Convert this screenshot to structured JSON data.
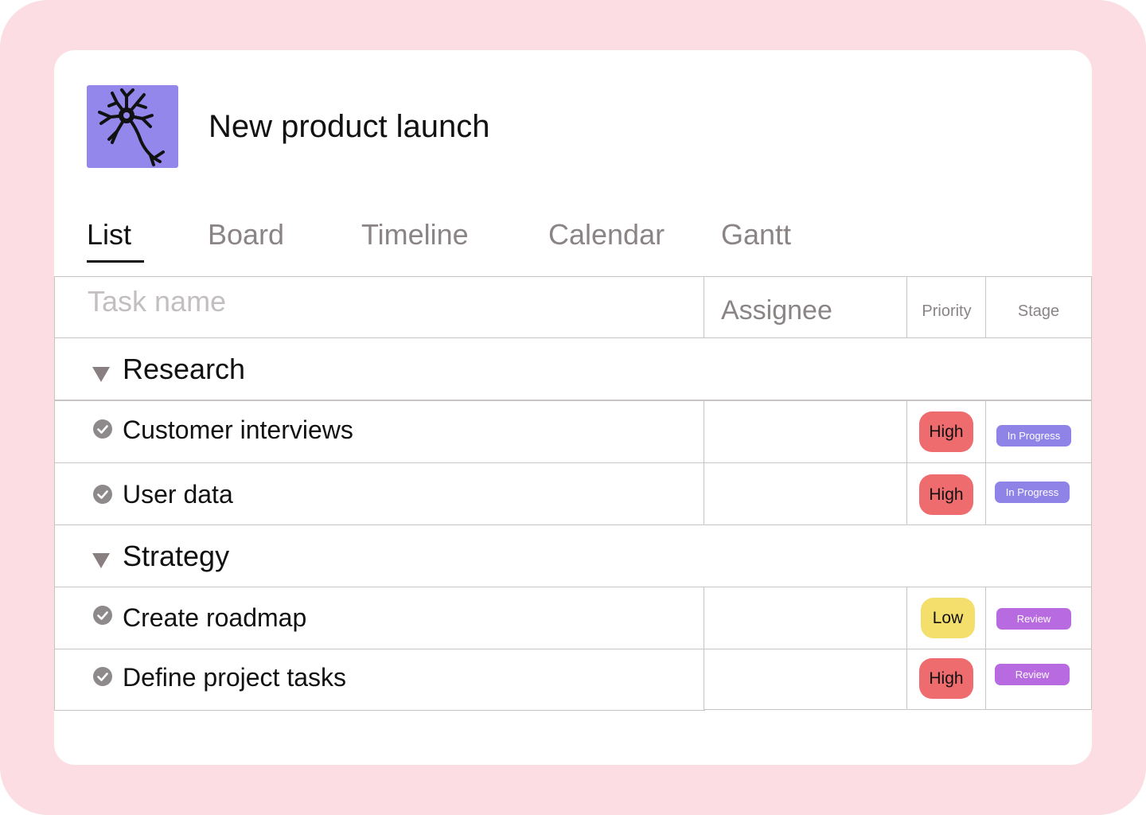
{
  "project": {
    "title": "New product launch",
    "logo_icon": "neuron-icon",
    "logo_color": "#9387ec"
  },
  "tabs": [
    {
      "label": "List",
      "active": true
    },
    {
      "label": "Board",
      "active": false
    },
    {
      "label": "Timeline",
      "active": false
    },
    {
      "label": "Calendar",
      "active": false
    },
    {
      "label": "Gantt",
      "active": false
    }
  ],
  "columns": {
    "task": "Task name",
    "assignee": "Assignee",
    "priority": "Priority",
    "stage": "Stage"
  },
  "groups": [
    {
      "name": "Research",
      "tasks": [
        {
          "name": "Customer interviews",
          "assignee": "",
          "priority": "High",
          "stage": "In Progress"
        },
        {
          "name": "User data",
          "assignee": "",
          "priority": "High",
          "stage": "In Progress"
        }
      ]
    },
    {
      "name": "Strategy",
      "tasks": [
        {
          "name": "Create roadmap",
          "assignee": "",
          "priority": "Low",
          "stage": "Review"
        },
        {
          "name": "Define project tasks",
          "assignee": "",
          "priority": "High",
          "stage": "Review"
        }
      ]
    }
  ],
  "colors": {
    "background": "#fcdde3",
    "priority_high": "#ee6b6e",
    "priority_low": "#f4de6c",
    "stage_in_progress": "#8f83e8",
    "stage_review": "#b86be0"
  }
}
